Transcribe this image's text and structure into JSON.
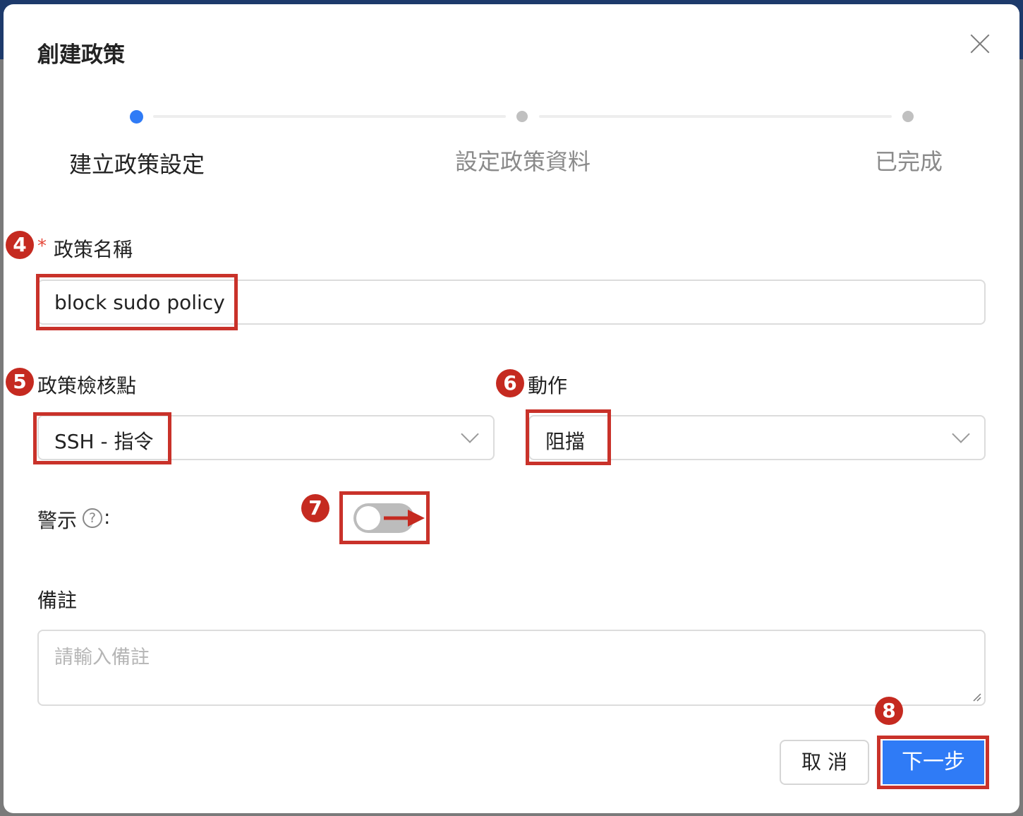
{
  "dialog": {
    "title": "創建政策",
    "close_icon": "close-icon"
  },
  "steps": [
    {
      "label": "建立政策設定",
      "state": "active"
    },
    {
      "label": "設定政策資料",
      "state": "inactive"
    },
    {
      "label": "已完成",
      "state": "inactive"
    }
  ],
  "form": {
    "policy_name": {
      "required_mark": "*",
      "label": "政策名稱",
      "value": "block sudo policy"
    },
    "checkpoint": {
      "label": "政策檢核點",
      "value": "SSH - 指令"
    },
    "action": {
      "label": "動作",
      "value": "阻擋"
    },
    "alert": {
      "label": "警示",
      "help_glyph": "?",
      "suffix": ":",
      "enabled": false
    },
    "notes": {
      "label": "備註",
      "placeholder": "請輸入備註",
      "value": ""
    }
  },
  "buttons": {
    "cancel": "取 消",
    "next": "下一步"
  },
  "annotations": {
    "badge_4": "4",
    "badge_5": "5",
    "badge_6": "6",
    "badge_7": "7",
    "badge_8": "8"
  },
  "colors": {
    "accent": "#2f7bf6",
    "annotation": "#c52a20",
    "required": "#e5483a"
  }
}
